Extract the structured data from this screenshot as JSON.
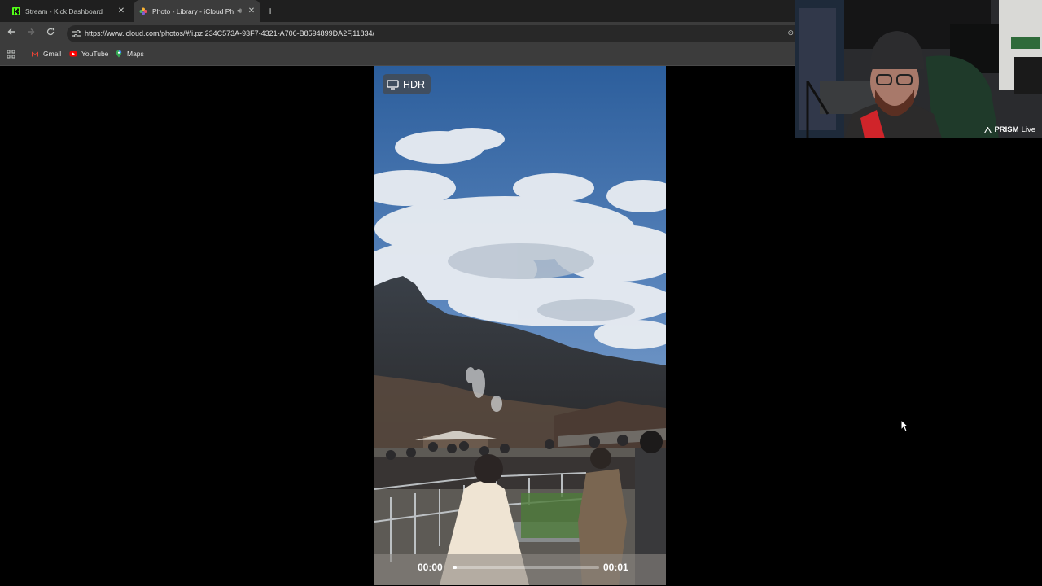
{
  "browser": {
    "tabs": [
      {
        "title": "Stream - Kick Dashboard",
        "icon": "kick-logo-icon",
        "active": false
      },
      {
        "title": "Photo - Library - iCloud Ph",
        "icon": "icloud-photos-icon",
        "active": true,
        "audio": true
      }
    ],
    "url": "https://www.icloud.com/photos/#/i.pz,234C573A-93F7-4321-A706-B8594899DA2F,11834/",
    "bookmarks": [
      {
        "label": "Gmail",
        "icon": "gmail-icon"
      },
      {
        "label": "YouTube",
        "icon": "youtube-icon"
      },
      {
        "label": "Maps",
        "icon": "maps-icon"
      }
    ]
  },
  "viewer": {
    "badge": "HDR",
    "time_start": "00:00",
    "time_end": "00:01",
    "progress": 0.03
  },
  "overlay": {
    "brand": "PRISM",
    "brand_suffix": "Live"
  },
  "colors": {
    "chrome_dark": "#1f1f1f",
    "chrome_toolbar": "#3c3c3c",
    "kick_green": "#53fc18",
    "sky_blue": "#3f6fa8"
  }
}
